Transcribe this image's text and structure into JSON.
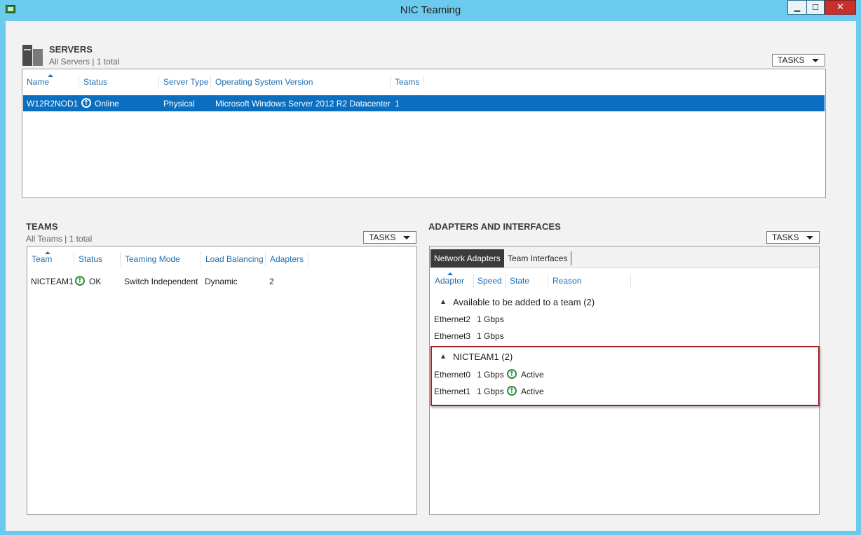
{
  "window": {
    "title": "NIC Teaming",
    "min_label": "▁",
    "max_label": "☐",
    "close_label": "✕",
    "icon": "nic-teaming-app-icon"
  },
  "servers": {
    "title": "SERVERS",
    "subtitle": "All Servers | 1 total",
    "tasks_label": "TASKS",
    "columns": [
      "Name",
      "Status",
      "Server Type",
      "Operating System Version",
      "Teams"
    ],
    "rows": [
      {
        "name": "W12R2NOD1",
        "status": "Online",
        "server_type": "Physical",
        "os_version": "Microsoft Windows Server 2012 R2 Datacenter",
        "teams": "1"
      }
    ]
  },
  "teams": {
    "title": "TEAMS",
    "subtitle": "All Teams | 1 total",
    "tasks_label": "TASKS",
    "columns": [
      "Team",
      "Status",
      "Teaming Mode",
      "Load Balancing",
      "Adapters"
    ],
    "rows": [
      {
        "team": "NICTEAM1",
        "status": "OK",
        "teaming_mode": "Switch Independent",
        "load_balancing": "Dynamic",
        "adapters": "2"
      }
    ]
  },
  "adapters": {
    "title": "ADAPTERS AND INTERFACES",
    "tasks_label": "TASKS",
    "tabs": [
      "Network Adapters",
      "Team Interfaces"
    ],
    "columns": [
      "Adapter",
      "Speed",
      "State",
      "Reason"
    ],
    "groups": [
      {
        "header": "Available to be added to a team (2)",
        "rows": [
          {
            "adapter": "Ethernet2",
            "speed": "1 Gbps",
            "state": ""
          },
          {
            "adapter": "Ethernet3",
            "speed": "1 Gbps",
            "state": ""
          }
        ]
      },
      {
        "header": "NICTEAM1 (2)",
        "rows": [
          {
            "adapter": "Ethernet0",
            "speed": "1 Gbps",
            "state": "Active"
          },
          {
            "adapter": "Ethernet1",
            "speed": "1 Gbps",
            "state": "Active"
          }
        ]
      }
    ]
  },
  "colors": {
    "title_bar": "#6ccaee",
    "selection": "#0b6fc1",
    "column_header": "#1f6fb3",
    "status_ok": "#2e8b3a",
    "highlight_box": "#a31f2a",
    "close_button": "#c7302b"
  }
}
